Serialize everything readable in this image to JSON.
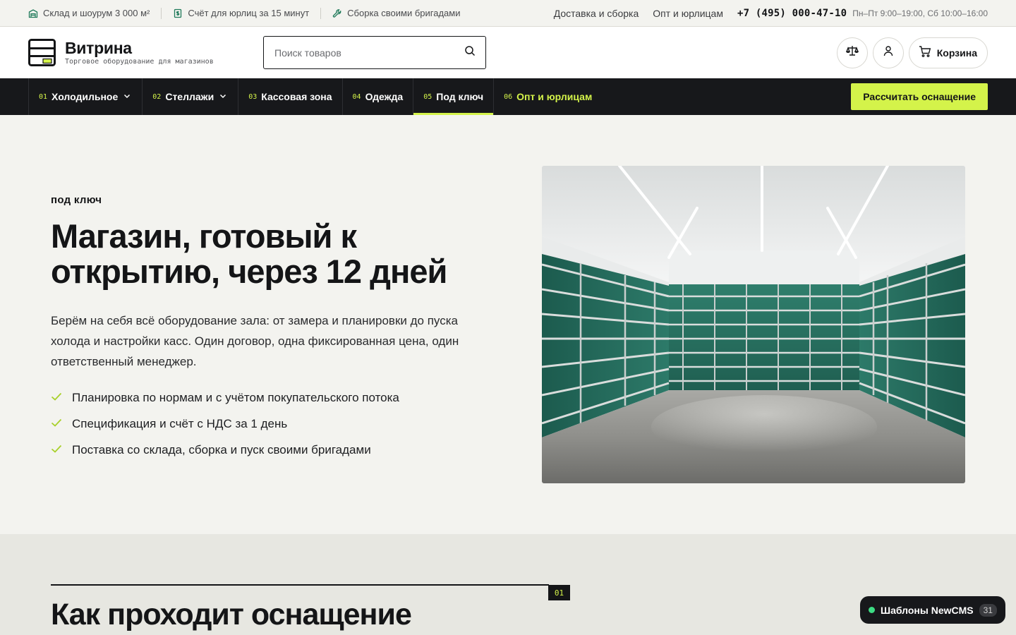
{
  "colors": {
    "accent": "#d4f34a",
    "dark": "#17181b",
    "bg": "#f3f3ef",
    "icon_green": "#1f7a5a"
  },
  "topbar": {
    "perks": [
      {
        "icon": "warehouse-icon",
        "text": "Склад и шоурум 3 000 м²"
      },
      {
        "icon": "invoice-icon",
        "text": "Счёт для юрлиц за 15 минут"
      },
      {
        "icon": "wrench-icon",
        "text": "Сборка своими бригадами"
      }
    ],
    "links": [
      "Доставка и сборка",
      "Опт и юрлицам"
    ],
    "phone": "+7 (495) 000-47-10",
    "hours": "Пн–Пт 9:00–19:00, Сб 10:00–16:00"
  },
  "header": {
    "logo_name": "Витрина",
    "logo_tagline": "Торговое оборудование для магазинов",
    "search_placeholder": "Поиск товаров",
    "cart_label": "Корзина"
  },
  "nav": {
    "items": [
      {
        "num": "01",
        "label": "Холодильное",
        "dropdown": true
      },
      {
        "num": "02",
        "label": "Стеллажи",
        "dropdown": true
      },
      {
        "num": "03",
        "label": "Кассовая зона"
      },
      {
        "num": "04",
        "label": "Одежда"
      },
      {
        "num": "05",
        "label": "Под ключ",
        "active": true
      },
      {
        "num": "06",
        "label": "Опт и юрлицам",
        "accent": true
      }
    ],
    "cta": "Рассчитать оснащение"
  },
  "hero": {
    "eyebrow": "под ключ",
    "title": "Магазин, готовый к открытию, через 12 дней",
    "lead": "Берём на себя всё оборудование зала: от замера и планировки до пуска холода и настройки касс. Один договор, одна фиксированная цена, один ответственный менеджер.",
    "bullets": [
      "Планировка по нормам и с учётом покупательского потока",
      "Спецификация и счёт с НДС за 1 день",
      "Поставка со склада, сборка и пуск своими бригадами"
    ]
  },
  "section": {
    "badge": "01",
    "title": "Как проходит оснащение"
  },
  "floating": {
    "label": "Шаблоны NewCMS",
    "count": "31"
  }
}
